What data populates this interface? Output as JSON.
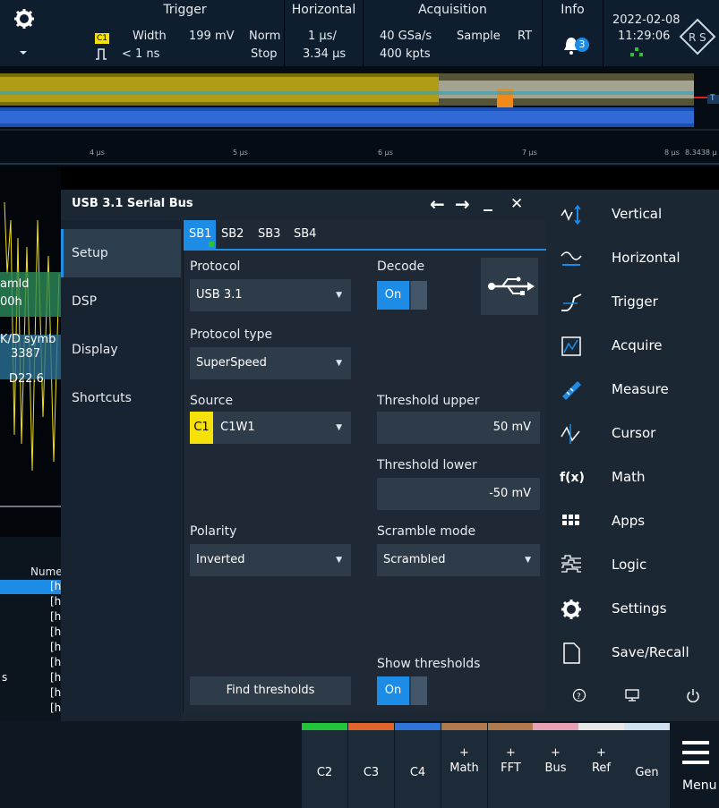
{
  "top": {
    "trigger": {
      "title": "Trigger",
      "src": "C1",
      "type": "Width",
      "level": "199 mV",
      "mode": "Norm",
      "cond": "< 1 ns",
      "state": "Stop"
    },
    "horizontal": {
      "title": "Horizontal",
      "scale": "1 µs/",
      "pos": "3.34 µs"
    },
    "acquisition": {
      "title": "Acquisition",
      "rate": "40 GSa/s",
      "mode": "Sample",
      "rt": "RT",
      "points": "400 kpts"
    },
    "info": {
      "title": "Info",
      "badge": "3"
    },
    "date": "2022-02-08",
    "time": "11:29:06"
  },
  "wave": {
    "ticks": [
      "4 µs",
      "5 µs",
      "6 µs",
      "7 µs",
      "8 µs",
      "8.3438 µ"
    ],
    "marker": "T"
  },
  "lower_left": {
    "labels": [
      "amld",
      "00h",
      "K/D symb",
      "3387",
      "D22.6"
    ]
  },
  "table": {
    "header": "Nume",
    "rows": [
      "[h",
      "[h",
      "[h",
      "[h",
      "[h",
      "[h",
      "[h",
      "[h",
      "[h"
    ],
    "side_label": "s"
  },
  "dialog": {
    "title": "USB 3.1 Serial Bus",
    "controls": {
      "back": "←",
      "forward": "→",
      "minimize": "_",
      "close": "✕"
    },
    "nav": [
      "Setup",
      "DSP",
      "Display",
      "Shortcuts"
    ],
    "tabs": [
      "SB1",
      "SB2",
      "SB3",
      "SB4"
    ],
    "protocol": {
      "label": "Protocol",
      "value": "USB 3.1"
    },
    "decode": {
      "label": "Decode",
      "state": "On"
    },
    "protocol_type": {
      "label": "Protocol type",
      "value": "SuperSpeed"
    },
    "source": {
      "label": "Source",
      "badge": "C1",
      "value": "C1W1"
    },
    "threshold_upper": {
      "label": "Threshold upper",
      "value": "50 mV"
    },
    "threshold_lower": {
      "label": "Threshold lower",
      "value": "-50 mV"
    },
    "polarity": {
      "label": "Polarity",
      "value": "Inverted"
    },
    "scramble": {
      "label": "Scramble mode",
      "value": "Scrambled"
    },
    "show_thresholds": {
      "label": "Show thresholds",
      "state": "On"
    },
    "find_thresholds": "Find thresholds"
  },
  "menu": {
    "items": [
      "Vertical",
      "Horizontal",
      "Trigger",
      "Acquire",
      "Measure",
      "Cursor",
      "Math",
      "Apps",
      "Logic",
      "Settings",
      "Save/Recall"
    ],
    "math_icon": "f(x)"
  },
  "softkeys": [
    {
      "top": "",
      "label": "C2",
      "color": "#22c43a"
    },
    {
      "top": "",
      "label": "C3",
      "color": "#e0632a"
    },
    {
      "top": "",
      "label": "C4",
      "color": "#2f74d8"
    },
    {
      "top": "+",
      "label": "Math",
      "color": "#b07a4e"
    },
    {
      "top": "+",
      "label": "FFT",
      "color": "#b07a4e"
    },
    {
      "top": "+",
      "label": "Bus",
      "color": "#e8a0b4"
    },
    {
      "top": "+",
      "label": "Ref",
      "color": "#e6e6e6"
    },
    {
      "top": "",
      "label": "Gen",
      "color": "#cfe0ee"
    }
  ],
  "menu_button": "Menu",
  "colors": {
    "accent": "#1c8ce6",
    "ch1": "#f5e10a",
    "panel": "#1b2733"
  }
}
